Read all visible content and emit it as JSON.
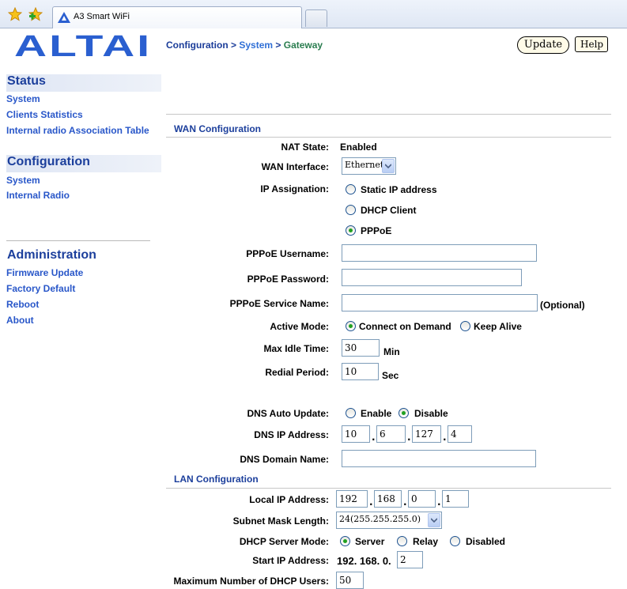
{
  "browser": {
    "tab_title": "A3 Smart WiFi"
  },
  "logo": {
    "text": "ALTAI"
  },
  "sidebar": {
    "status": {
      "heading": "Status",
      "links": [
        "System",
        "Clients Statistics",
        "Internal radio Association Table"
      ]
    },
    "configuration": {
      "heading": "Configuration",
      "links": [
        "System",
        "Internal Radio"
      ]
    },
    "administration": {
      "heading": "Administration",
      "links": [
        "Firmware Update",
        "Factory Default",
        "Reboot",
        "About"
      ]
    }
  },
  "header": {
    "breadcrumb": {
      "part1": "Configuration >",
      "part2": "System",
      "sep": ">",
      "part3": "Gateway"
    },
    "update_label": "Update",
    "help_label": "Help"
  },
  "wan": {
    "title": "WAN Configuration",
    "nat_state_label": "NAT State:",
    "nat_state_value": "Enabled",
    "wan_interface_label": "WAN Interface:",
    "wan_interface_value": "Ethernet",
    "ip_assignation_label": "IP Assignation:",
    "ip_options": [
      "Static IP address",
      "DHCP Client",
      "PPPoE"
    ],
    "ip_selected": "PPPoE",
    "pppoe_username_label": "PPPoE Username:",
    "pppoe_username_value": "",
    "pppoe_password_label": "PPPoE Password:",
    "pppoe_password_value": "",
    "pppoe_service_label": "PPPoE Service Name:",
    "pppoe_service_value": "",
    "optional_note": "(Optional)",
    "active_mode_label": "Active Mode:",
    "active_mode_options": [
      "Connect on Demand",
      "Keep Alive"
    ],
    "active_mode_selected": "Connect on Demand",
    "max_idle_label": "Max Idle Time:",
    "max_idle_value": "30",
    "max_idle_unit": "Min",
    "redial_label": "Redial Period:",
    "redial_value": "10",
    "redial_unit": "Sec",
    "dns_auto_label": "DNS Auto Update:",
    "dns_auto_options": [
      "Enable",
      "Disable"
    ],
    "dns_auto_selected": "Disable",
    "dns_ip_label": "DNS IP Address:",
    "dns_ip": [
      "10",
      "6",
      "127",
      "4"
    ],
    "dns_domain_label": "DNS Domain Name:",
    "dns_domain_value": ""
  },
  "lan": {
    "title": "LAN Configuration",
    "local_ip_label": "Local IP Address:",
    "local_ip": [
      "192",
      "168",
      "0",
      "1"
    ],
    "subnet_label": "Subnet Mask Length:",
    "subnet_value": "24(255.255.255.0)",
    "dhcp_mode_label": "DHCP Server Mode:",
    "dhcp_mode_options": [
      "Server",
      "Relay",
      "Disabled"
    ],
    "dhcp_mode_selected": "Server",
    "start_ip_label": "Start IP Address:",
    "start_ip_prefix": "192. 168. 0.",
    "start_ip_last": "2",
    "max_users_label": "Maximum Number of DHCP Users:",
    "max_users_value": "50"
  },
  "colors": {
    "heading_blue": "#1c3f9c",
    "link_blue": "#2957c9",
    "logo_blue": "#2a5fd0",
    "breadcrumb_green": "#2a7d4f",
    "radio_green": "#21a121"
  },
  "icons": [
    "favorites-star-icon",
    "add-favorite-icon",
    "altai-favicon-icon",
    "dropdown-arrow-icon"
  ]
}
